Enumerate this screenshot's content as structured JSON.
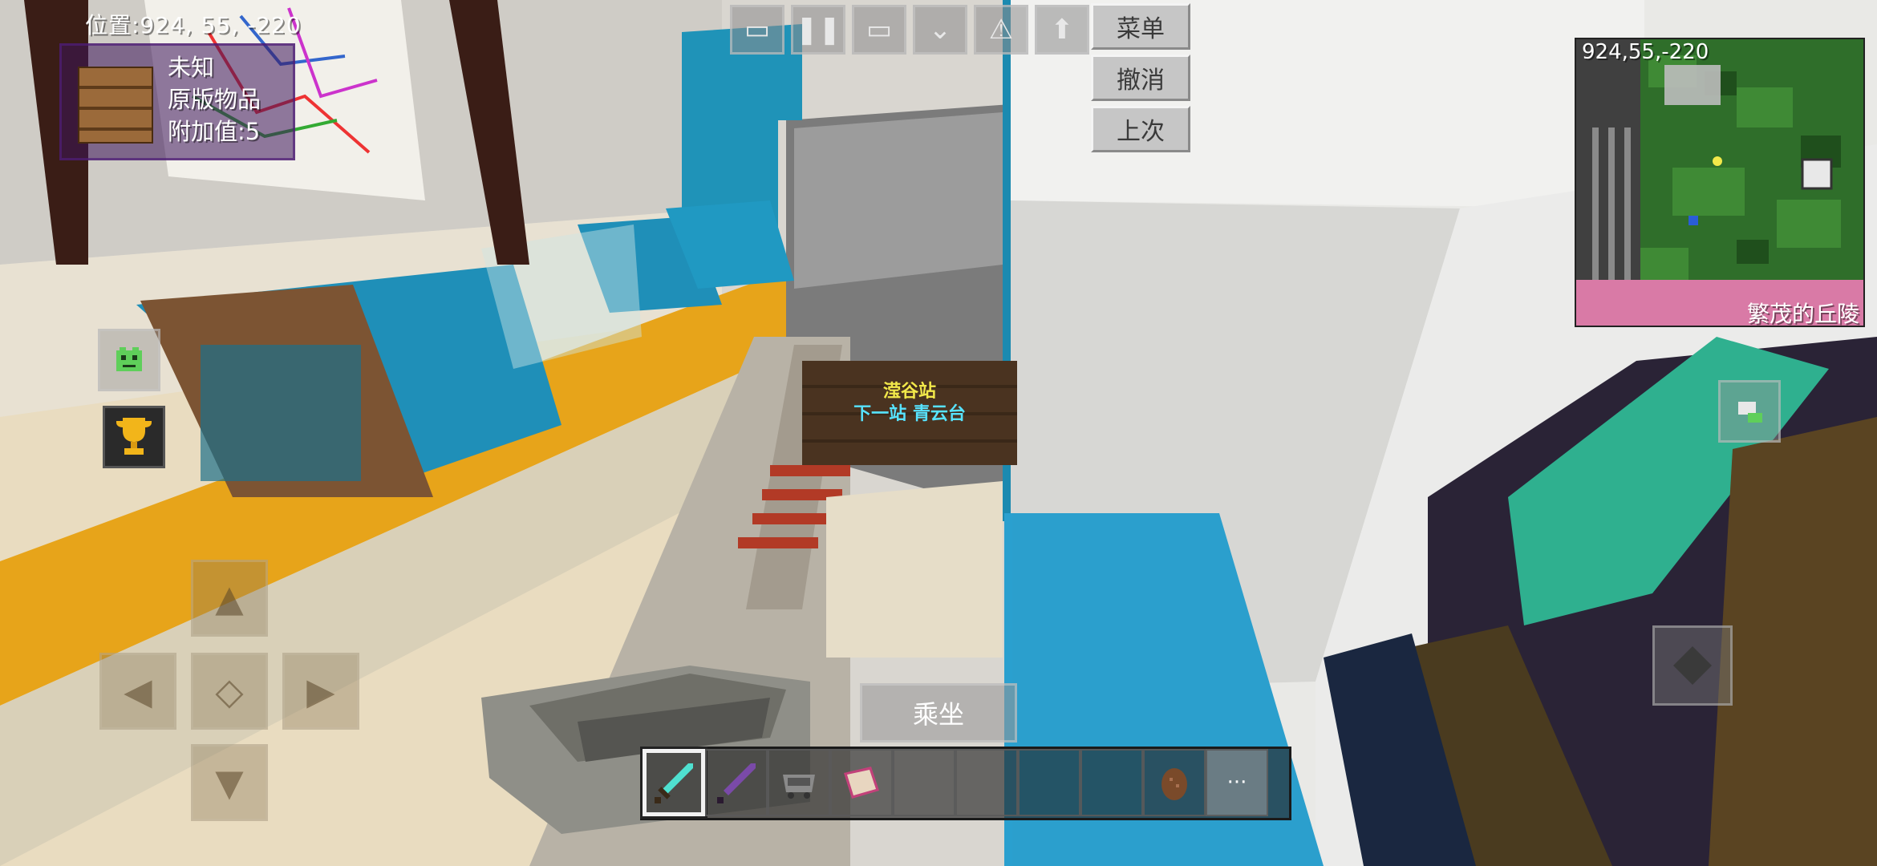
{
  "hud": {
    "position_label": "位置:924, 55, -220",
    "item_name": "未知",
    "item_source": "原版物品",
    "item_aux": "附加值:5"
  },
  "toolbar": {
    "menu_label": "菜单",
    "undo_label": "撤消",
    "last_label": "上次"
  },
  "minimap": {
    "coords": "924,55,-220",
    "biome": "繁茂的丘陵"
  },
  "sign": {
    "line1": "滢谷站",
    "line2": "下一站  青云台"
  },
  "actions": {
    "ride_label": "乘坐"
  },
  "hotbar": {
    "selected_index": 0,
    "slots": [
      "diamond-sword-icon",
      "netherite-sword-icon",
      "minecart-icon",
      "book-icon",
      "empty",
      "empty",
      "empty",
      "empty",
      "cocoa-icon"
    ],
    "more_label": "···"
  },
  "colors": {
    "accent_cyan": "#57e3ff",
    "sign_yellow": "#f2e84a",
    "menu_bg": "#c6c6c6"
  }
}
